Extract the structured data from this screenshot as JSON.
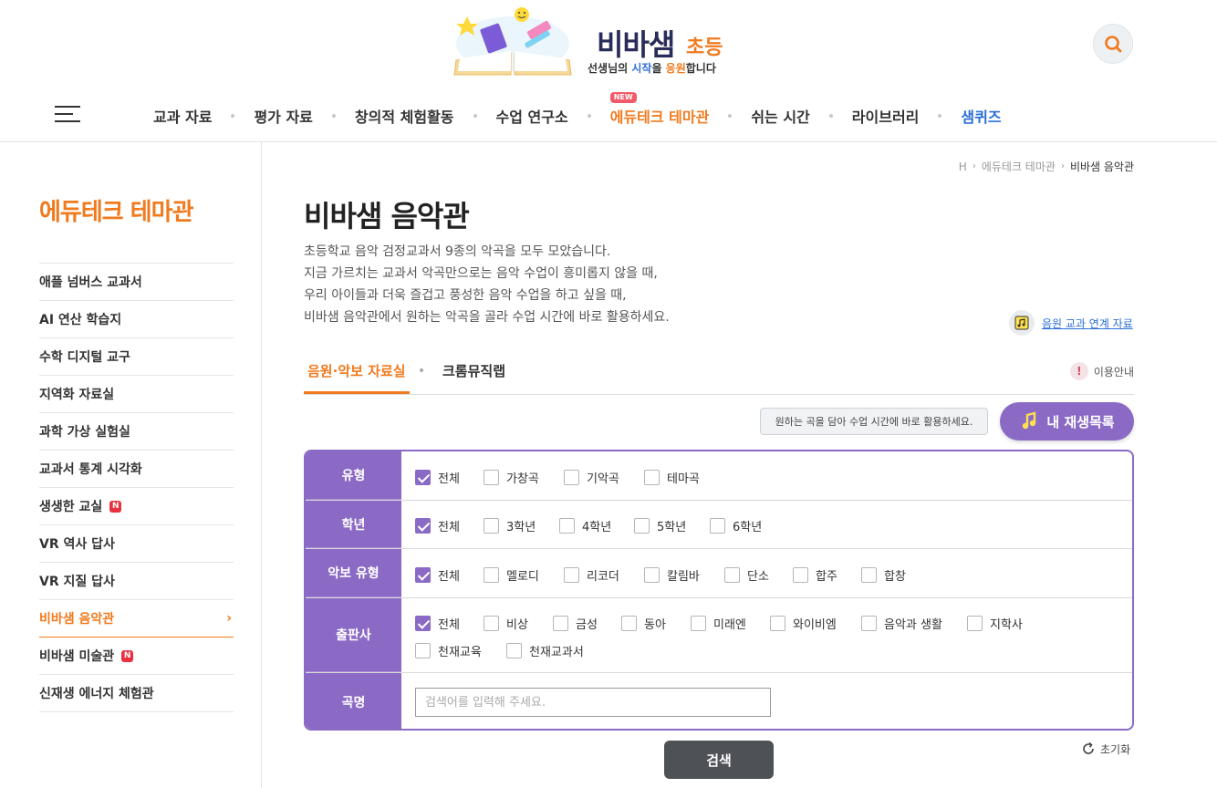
{
  "header": {
    "brand": "비바샘",
    "brand_sub": "초등",
    "tagline_pre": "선생님의 ",
    "tagline_b": "시작",
    "tagline_mid": "을 ",
    "tagline_o": "응원",
    "tagline_post": "합니다",
    "new_badge": "NEW",
    "nav": [
      "교과 자료",
      "평가 자료",
      "창의적 체험활동",
      "수업 연구소",
      "에듀테크 테마관",
      "쉬는 시간",
      "라이브러리",
      "샘퀴즈"
    ]
  },
  "sidebar": {
    "title": "에듀테크 테마관",
    "n_badge": "N",
    "items": [
      {
        "label": "애플 넘버스 교과서"
      },
      {
        "label": "AI 연산 학습지"
      },
      {
        "label": "수학 디지털 교구"
      },
      {
        "label": "지역화 자료실"
      },
      {
        "label": "과학 가상 실험실"
      },
      {
        "label": "교과서 통계 시각화"
      },
      {
        "label": "생생한 교실"
      },
      {
        "label": "VR 역사 답사"
      },
      {
        "label": "VR 지질 답사"
      },
      {
        "label": "비바샘 음악관"
      },
      {
        "label": "비바샘 미술관"
      },
      {
        "label": "신재생 에너지 체험관"
      }
    ],
    "chevron": "›"
  },
  "breadcrumb": {
    "home": "H",
    "level1": "에듀테크 테마관",
    "current": "비바샘 음악관",
    "sep": "›"
  },
  "main": {
    "title": "비바샘 음악관",
    "desc": [
      "초등학교 음악 검정교과서 9종의 악곡을 모두 모았습니다.",
      "지금 가르치는 교과서 악곡만으로는 음악 수업이 흥미롭지 않을 때,",
      "우리 아이들과 더욱 즐겁고 풍성한 음악 수업을 하고 싶을 때,",
      "비바샘 음악관에서 원하는 악곡을 골라 수업 시간에 바로 활용하세요."
    ],
    "link_label": "음원 교과 연계 자료",
    "tabs": [
      "음원·악보 자료실",
      "크롬뮤직랩"
    ],
    "usage_label": "이용안내",
    "usage_icon": "!",
    "tooltip": "원하는 곡을 담아 수업 시간에 바로 활용하세요.",
    "playlist_label": "내 재생목록"
  },
  "filters": {
    "type": {
      "label": "유형",
      "options": [
        "전체",
        "가창곡",
        "기악곡",
        "테마곡"
      ]
    },
    "grade": {
      "label": "학년",
      "options": [
        "전체",
        "3학년",
        "4학년",
        "5학년",
        "6학년"
      ]
    },
    "score": {
      "label": "악보 유형",
      "options": [
        "전체",
        "멜로디",
        "리코더",
        "칼림바",
        "단소",
        "합주",
        "합창"
      ]
    },
    "publisher": {
      "label": "출판사",
      "options": [
        "전체",
        "비상",
        "금성",
        "동아",
        "미래엔",
        "와이비엠",
        "음악과 생활",
        "지학사",
        "천재교육",
        "천재교과서"
      ]
    },
    "title": {
      "label": "곡명",
      "placeholder": "검색어를 입력해 주세요.",
      "value": ""
    }
  },
  "actions": {
    "search_label": "검색",
    "reset_label": "초기화"
  },
  "colors": {
    "accent": "#f07a1e",
    "purple": "#8b6ac6",
    "blue": "#2c6fd6",
    "dark_button": "#4e5156"
  }
}
